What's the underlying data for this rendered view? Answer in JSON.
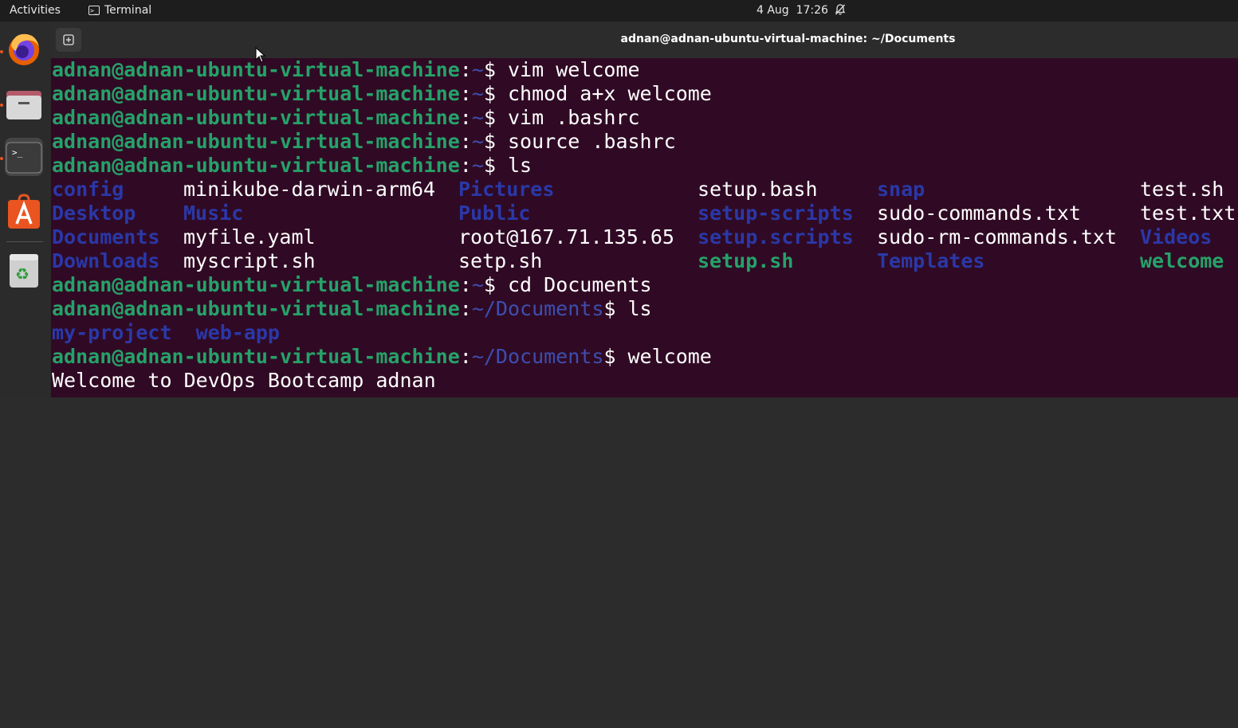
{
  "topbar": {
    "activities": "Activities",
    "app_name": "Terminal",
    "date": "4 Aug",
    "time": "17:26",
    "bell_icon": "bell-muted-icon"
  },
  "dock": {
    "items": [
      "firefox-icon",
      "files-icon",
      "terminal-icon",
      "app-center-icon",
      "trash-icon"
    ]
  },
  "window": {
    "title": "adnan@adnan-ubuntu-virtual-machine: ~/Documents"
  },
  "terminal": {
    "prompt_user": "adnan@adnan-ubuntu-virtual-machine",
    "colon": ":",
    "home_path": "~",
    "docs_path": "~/Documents",
    "dollar": "$ ",
    "commands": {
      "c1": "vim welcome",
      "c2": "chmod a+x welcome",
      "c3": "vim .bashrc",
      "c4": "source .bashrc",
      "c5": "ls",
      "c6": "cd Documents",
      "c7": "ls",
      "c8": "welcome"
    },
    "ls_grid": [
      [
        {
          "t": "config",
          "k": "d"
        },
        {
          "t": "minikube-darwin-arm64",
          "k": "f"
        },
        {
          "t": "Pictures",
          "k": "d"
        },
        {
          "t": "setup.bash",
          "k": "f"
        },
        {
          "t": "snap",
          "k": "d"
        },
        {
          "t": "test.sh",
          "k": "f"
        }
      ],
      [
        {
          "t": "Desktop",
          "k": "d"
        },
        {
          "t": "Music",
          "k": "d"
        },
        {
          "t": "Public",
          "k": "d"
        },
        {
          "t": "setup-scripts",
          "k": "d"
        },
        {
          "t": "sudo-commands.txt",
          "k": "f"
        },
        {
          "t": "test.txt",
          "k": "f"
        }
      ],
      [
        {
          "t": "Documents",
          "k": "d"
        },
        {
          "t": "myfile.yaml",
          "k": "f"
        },
        {
          "t": "root@167.71.135.65",
          "k": "f"
        },
        {
          "t": "setup.scripts",
          "k": "d"
        },
        {
          "t": "sudo-rm-commands.txt",
          "k": "f"
        },
        {
          "t": "Videos",
          "k": "d"
        }
      ],
      [
        {
          "t": "Downloads",
          "k": "d"
        },
        {
          "t": "myscript.sh",
          "k": "f"
        },
        {
          "t": "setp.sh",
          "k": "f"
        },
        {
          "t": "setup.sh",
          "k": "x"
        },
        {
          "t": "Templates",
          "k": "d"
        },
        {
          "t": "welcome",
          "k": "x"
        }
      ]
    ],
    "docs_ls": [
      "my-project",
      "web-app"
    ],
    "output": "Welcome to DevOps Bootcamp adnan"
  },
  "colors": {
    "terminal_bg": "#300a24",
    "user": "#26a269",
    "directory": "#2a38a8",
    "path": "#3d4eb0",
    "executable": "#26a269",
    "accent": "#e95420"
  }
}
